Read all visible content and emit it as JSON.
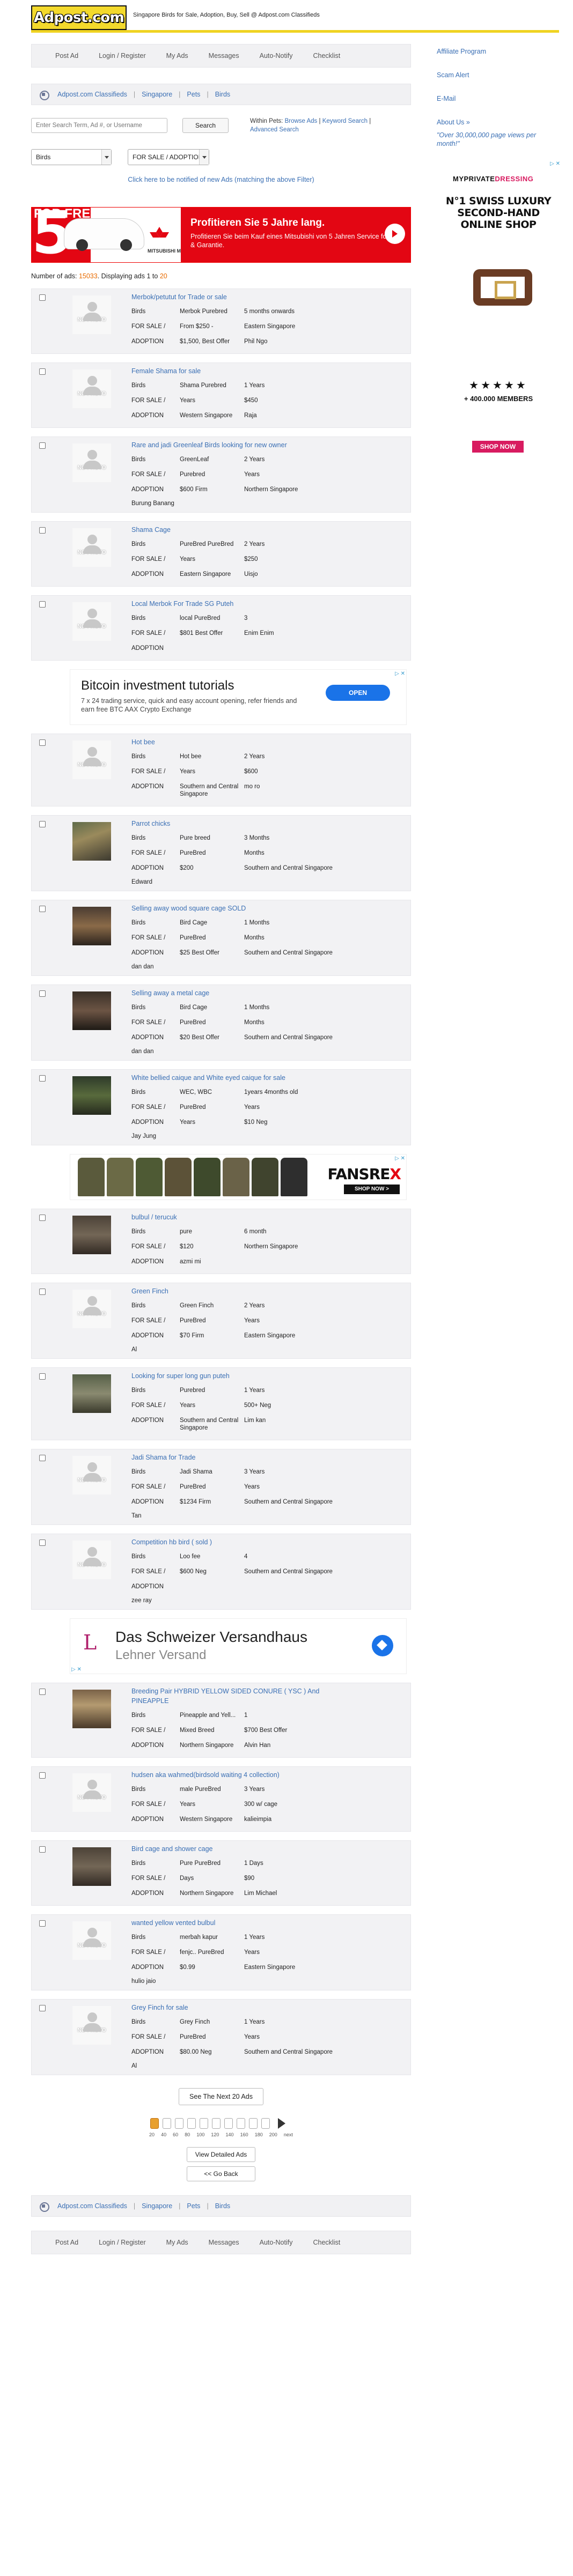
{
  "header": {
    "logo": "Adpost.com",
    "tagline": "Singapore Birds for Sale, Adoption, Buy, Sell @ Adpost.com Classifieds"
  },
  "nav": [
    "Post Ad",
    "Login / Register",
    "My Ads",
    "Messages",
    "Auto-Notify",
    "Checklist"
  ],
  "breadcrumb": [
    "Adpost.com Classifieds",
    "Singapore",
    "Pets",
    "Birds"
  ],
  "search": {
    "placeholder": "Enter Search Term, Ad #, or Username",
    "button": "Search",
    "within_label": "Within Pets:",
    "browse": "Browse Ads",
    "keyword": "Keyword Search",
    "advanced": "Advanced Search"
  },
  "filters": {
    "category": "Birds",
    "type": "FOR SALE / ADOPTION"
  },
  "notify": "Click here to be notified of new Ads (matching the above Filter)",
  "banner": {
    "left": "FOR FREE",
    "brand": "MITSUBISHI MOTORS",
    "headline": "Profitieren Sie 5 Jahre lang.",
    "sub": "Profitieren Sie beim Kauf eines Mitsubishi von 5 Jahren Service for Free & Garantie."
  },
  "count": {
    "prefix": "Number of ads:",
    "total": "15033",
    "mid": ". Displaying ads",
    "from": "1",
    "to_label": "to",
    "to": "20"
  },
  "nophoto": "NO PHOTO",
  "listings": [
    {
      "title": "Merbok/petutut for Trade or sale",
      "c1": [
        "Birds",
        "FOR SALE /",
        "ADOPTION"
      ],
      "c2": [
        "Merbok Purebred",
        "From $250 -",
        "$1,500, Best Offer"
      ],
      "c3": [
        "5 months onwards",
        "Eastern Singapore",
        "Phil Ngo"
      ],
      "extra": "",
      "img": "np"
    },
    {
      "title": "Female Shama for sale",
      "c1": [
        "Birds",
        "FOR SALE /",
        "ADOPTION"
      ],
      "c2": [
        "Shama Purebred",
        "Years",
        "Western Singapore"
      ],
      "c3": [
        "1 Years",
        "$450",
        "Raja"
      ],
      "extra": "",
      "img": "np"
    },
    {
      "title": "Rare and jadi Greenleaf Birds looking for new owner",
      "c1": [
        "Birds",
        "FOR SALE /",
        "ADOPTION"
      ],
      "c2": [
        "GreenLeaf",
        "Purebred",
        "$600 Firm"
      ],
      "c3": [
        "2 Years",
        "Years",
        "Northern Singapore"
      ],
      "extra": "Burung Banang",
      "img": "np"
    },
    {
      "title": "Shama Cage",
      "c1": [
        "Birds",
        "FOR SALE /",
        "ADOPTION"
      ],
      "c2": [
        "PureBred PureBred",
        "Years",
        "Eastern Singapore"
      ],
      "c3": [
        "2 Years",
        "$250",
        "Uisjo"
      ],
      "extra": "",
      "img": "np"
    },
    {
      "title": "Local Merbok For Trade SG Puteh",
      "c1": [
        "Birds",
        "FOR SALE /",
        "ADOPTION"
      ],
      "c2": [
        "local PureBred",
        "$801 Best Offer",
        ""
      ],
      "c3": [
        "3",
        "Enim Enim",
        ""
      ],
      "extra": "",
      "img": "np"
    },
    {
      "title": "Hot bee",
      "c1": [
        "Birds",
        "FOR SALE /",
        "ADOPTION"
      ],
      "c2": [
        "Hot bee",
        "Years",
        "Southern and Central Singapore"
      ],
      "c3": [
        "2 Years",
        "$600",
        "mo ro"
      ],
      "extra": "",
      "img": "np"
    },
    {
      "title": "Parrot chicks",
      "c1": [
        "Birds",
        "FOR SALE /",
        "ADOPTION"
      ],
      "c2": [
        "Pure breed",
        "PureBred",
        "$200"
      ],
      "c3": [
        "3 Months",
        "Months",
        "Southern and Central Singapore"
      ],
      "extra": "Edward",
      "img": "ph1"
    },
    {
      "title": "Selling away wood square cage SOLD",
      "c1": [
        "Birds",
        "FOR SALE /",
        "ADOPTION"
      ],
      "c2": [
        "Bird Cage",
        "PureBred",
        "$25 Best Offer"
      ],
      "c3": [
        "1 Months",
        "Months",
        "Southern and Central Singapore"
      ],
      "extra": "dan dan",
      "img": "ph2"
    },
    {
      "title": "Selling away a metal cage",
      "c1": [
        "Birds",
        "FOR SALE /",
        "ADOPTION"
      ],
      "c2": [
        "Bird Cage",
        "PureBred",
        "$20 Best Offer"
      ],
      "c3": [
        "1 Months",
        "Months",
        "Southern and Central Singapore"
      ],
      "extra": "dan dan",
      "img": "ph3"
    },
    {
      "title": "White bellied caique and White eyed caique for sale",
      "c1": [
        "Birds",
        "FOR SALE /",
        "ADOPTION"
      ],
      "c2": [
        "WEC, WBC",
        "PureBred",
        "Years"
      ],
      "c3": [
        "1years 4months old",
        "Years",
        "$10 Neg"
      ],
      "extra": "Jay Jung",
      "img": "ph4"
    },
    {
      "title": "bulbul / terucuk",
      "c1": [
        "Birds",
        "FOR SALE /",
        "ADOPTION"
      ],
      "c2": [
        "pure",
        "$120",
        "azmi mi"
      ],
      "c3": [
        "6 month",
        "Northern Singapore",
        ""
      ],
      "extra": "",
      "img": "ph5"
    },
    {
      "title": "Green Finch",
      "c1": [
        "Birds",
        "FOR SALE /",
        "ADOPTION"
      ],
      "c2": [
        "Green Finch",
        "PureBred",
        "$70 Firm"
      ],
      "c3": [
        "2 Years",
        "Years",
        "Eastern Singapore"
      ],
      "extra": "Al",
      "img": "np"
    },
    {
      "title": "Looking for super long gun puteh",
      "c1": [
        "Birds",
        "FOR SALE /",
        "ADOPTION"
      ],
      "c2": [
        "Purebred",
        "Years",
        "Southern and Central Singapore"
      ],
      "c3": [
        "1 Years",
        "500+ Neg",
        "Lim kan"
      ],
      "extra": "",
      "img": "ph6"
    },
    {
      "title": "Jadi Shama for Trade",
      "c1": [
        "Birds",
        "FOR SALE /",
        "ADOPTION"
      ],
      "c2": [
        "Jadi Shama",
        "PureBred",
        "$1234 Firm"
      ],
      "c3": [
        "3 Years",
        "Years",
        "Southern and Central Singapore"
      ],
      "extra": "Tan",
      "img": "np"
    },
    {
      "title": "Competition hb bird ( sold )",
      "c1": [
        "Birds",
        "FOR SALE /",
        "ADOPTION"
      ],
      "c2": [
        "Loo fee",
        "$600 Neg",
        ""
      ],
      "c3": [
        "4",
        "Southern and Central Singapore",
        ""
      ],
      "extra": "zee ray",
      "img": "np"
    },
    {
      "title": "Breeding Pair HYBRID YELLOW SIDED CONURE ( YSC ) And PINEAPPLE",
      "c1": [
        "Birds",
        "FOR SALE /",
        "ADOPTION"
      ],
      "c2": [
        "Pineapple and Yell...",
        "Mixed Breed",
        "Northern Singapore"
      ],
      "c3": [
        "1",
        "$700 Best Offer",
        "Alvin Han"
      ],
      "extra": "",
      "img": "ph7"
    },
    {
      "title": "hudsen aka wahmed(birdsold waiting 4 collection)",
      "c1": [
        "Birds",
        "FOR SALE /",
        "ADOPTION"
      ],
      "c2": [
        "male PureBred",
        "Years",
        "Western Singapore"
      ],
      "c3": [
        "3 Years",
        "300 w/ cage",
        "kalieimpia"
      ],
      "extra": "",
      "img": "np"
    },
    {
      "title": "Bird cage and shower cage",
      "c1": [
        "Birds",
        "FOR SALE /",
        "ADOPTION"
      ],
      "c2": [
        "Pure PureBred",
        "Days",
        "Northern Singapore"
      ],
      "c3": [
        "1 Days",
        "$90",
        "Lim Michael"
      ],
      "extra": "",
      "img": "ph5"
    },
    {
      "title": "wanted yellow vented bulbul",
      "c1": [
        "Birds",
        "FOR SALE /",
        "ADOPTION"
      ],
      "c2": [
        "merbah kapur",
        "fenjc.. PureBred",
        "$0.99"
      ],
      "c3": [
        "1 Years",
        "Years",
        "Eastern Singapore"
      ],
      "extra": "hulio jaio",
      "img": "np"
    },
    {
      "title": "Grey Finch for sale",
      "c1": [
        "Birds",
        "FOR SALE /",
        "ADOPTION"
      ],
      "c2": [
        "Grey Finch",
        "PureBred",
        "$80.00 Neg"
      ],
      "c3": [
        "1 Years",
        "Years",
        "Southern and Central Singapore"
      ],
      "extra": "Al",
      "img": "np"
    }
  ],
  "ads": {
    "btc": {
      "title": "Bitcoin investment tutorials",
      "text": "7 x 24 trading service, quick and easy account opening, refer friends and earn free BTC AAX Crypto Exchange",
      "button": "OPEN"
    },
    "fansrex": {
      "brand_a": "FANSRE",
      "brand_b": "X",
      "button": "SHOP NOW >"
    },
    "schw": {
      "letter": "L",
      "line1": "Das Schweizer Versandhaus",
      "line2": "Lehner Versand"
    }
  },
  "pagination": {
    "next": "See The Next 20 Ads",
    "nums": [
      "20",
      "40",
      "60",
      "80",
      "100",
      "120",
      "140",
      "160",
      "180",
      "200",
      "next"
    ],
    "view_detailed": "View Detailed Ads",
    "go_back": "<< Go Back"
  },
  "sidebar": {
    "links": [
      "Affiliate Program",
      "Scam Alert",
      "E-Mail",
      "About Us »"
    ],
    "quote": "\"Over 30,000,000 page views per month!\""
  },
  "mpd": {
    "brand_a": "MYPRIVATE",
    "brand_b": "DRESSING",
    "tagline": "N°1 SWISS LUXURY SECOND-HAND ONLINE SHOP",
    "stars": "★★★★★",
    "members": "+ 400.000 MEMBERS",
    "button": "SHOP NOW"
  },
  "colors": {
    "accent": "#f3d92c",
    "link": "#3a6fb4",
    "highlight": "#e86b00"
  }
}
